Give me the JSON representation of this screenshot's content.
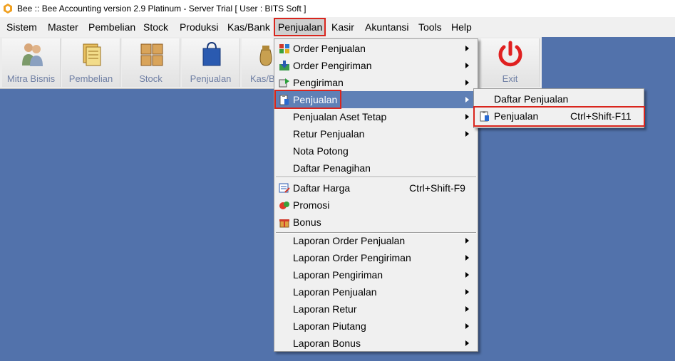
{
  "window": {
    "title": "Bee :: Bee Accounting version 2.9 Platinum - Server Trial [ User : BITS Soft ]"
  },
  "menubar": {
    "items": [
      "Sistem",
      "Master",
      "Pembelian",
      "Stock",
      "Produksi",
      "Kas/Bank",
      "Penjualan",
      "Kasir",
      "Akuntansi",
      "Tools",
      "Help"
    ],
    "active": "Penjualan"
  },
  "toolbar": {
    "buttons": [
      "Mitra Bisnis",
      "Pembelian",
      "Stock",
      "Penjualan",
      "Kas/B",
      "Exit"
    ]
  },
  "penjualan_menu": {
    "items": [
      {
        "label": "Order Penjualan",
        "has_submenu": true,
        "icon": "order-icon"
      },
      {
        "label": "Order Pengiriman",
        "has_submenu": true,
        "icon": "download-icon"
      },
      {
        "label": "Pengiriman",
        "has_submenu": true,
        "icon": "shipping-icon"
      },
      {
        "label": "Penjualan",
        "has_submenu": true,
        "icon": "sales-icon",
        "highlighted": true
      },
      {
        "label": "Penjualan Aset Tetap",
        "has_submenu": true
      },
      {
        "label": "Retur Penjualan",
        "has_submenu": true
      },
      {
        "label": "Nota Potong",
        "has_submenu": false
      },
      {
        "label": "Daftar Penagihan",
        "has_submenu": false
      }
    ],
    "items2": [
      {
        "label": "Daftar Harga",
        "shortcut": "Ctrl+Shift-F9",
        "icon": "price-list-icon"
      },
      {
        "label": "Promosi",
        "icon": "promo-icon"
      },
      {
        "label": "Bonus",
        "icon": "bonus-icon"
      }
    ],
    "reports": [
      "Laporan Order Penjualan",
      "Laporan Order Pengiriman",
      "Laporan Pengiriman",
      "Laporan Penjualan",
      "Laporan Retur",
      "Laporan Piutang",
      "Laporan Bonus"
    ]
  },
  "submenu": {
    "items": [
      {
        "label": "Daftar Penjualan"
      },
      {
        "label": "Penjualan",
        "shortcut": "Ctrl+Shift-F11",
        "icon": "sales-icon"
      }
    ]
  },
  "colors": {
    "desktop": "#5272ab",
    "highlight": "#5f80b6",
    "annotation": "#d9251d"
  }
}
